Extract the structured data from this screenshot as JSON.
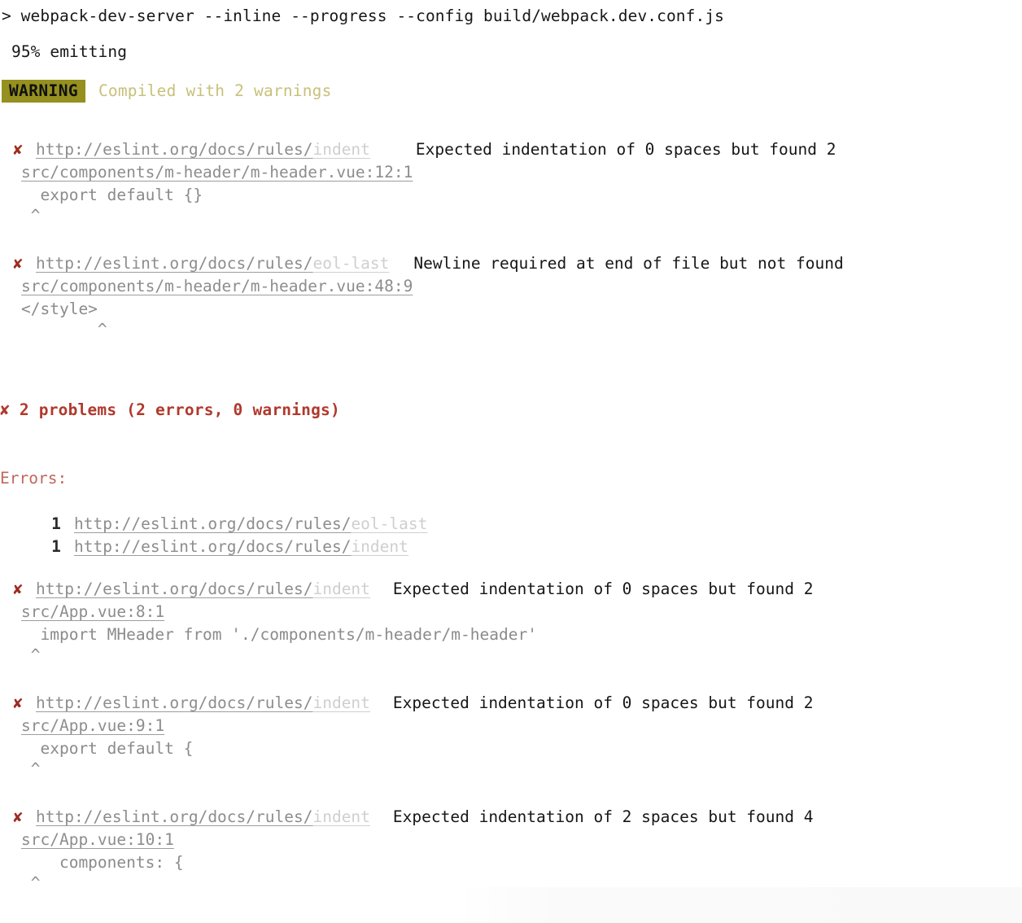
{
  "command": {
    "prompt": ">",
    "text": "> webpack-dev-server --inline --progress --config build/webpack.dev.conf.js"
  },
  "progress": {
    "text": "95% emitting"
  },
  "warning_banner": {
    "badge": "WARNING",
    "message": "Compiled with 2 warnings",
    "badge_bg": "#95901f",
    "badge_fg": "#101010",
    "message_color": "#c8c07a"
  },
  "icons": {
    "error_mark": "✘",
    "caret": "^"
  },
  "url_base": "http://eslint.org/docs/rules/",
  "problems": [
    {
      "mark": "✘",
      "rule": "indent",
      "message": "Expected indentation of 0 spaces but found 2",
      "file": "src/components/m-header/m-header.vue:12:1",
      "code": "  export default {}",
      "caret": " ^"
    },
    {
      "mark": "✘",
      "rule": "eol-last",
      "message": "Newline required at end of file but not found",
      "file": "src/components/m-header/m-header.vue:48:9",
      "code": "</style>",
      "caret": "        ^"
    }
  ],
  "summary": {
    "mark": "✘",
    "text": "✘ 2 problems (2 errors, 0 warnings)",
    "color": "#b0392c"
  },
  "errors_section": {
    "heading": "Errors:",
    "heading_color": "#c0675c",
    "rows": [
      {
        "count": "1",
        "rule": "eol-last"
      },
      {
        "count": "1",
        "rule": "indent"
      }
    ]
  },
  "problems2": [
    {
      "mark": "✘",
      "rule": "indent",
      "message": "Expected indentation of 0 spaces but found 2",
      "file": "src/App.vue:8:1",
      "code": "  import MHeader from './components/m-header/m-header'",
      "caret": " ^"
    },
    {
      "mark": "✘",
      "rule": "indent",
      "message": "Expected indentation of 0 spaces but found 2",
      "file": "src/App.vue:9:1",
      "code": "  export default {",
      "caret": " ^"
    },
    {
      "mark": "✘",
      "rule": "indent",
      "message": "Expected indentation of 2 spaces but found 4",
      "file": "src/App.vue:10:1",
      "code": "    components: {",
      "caret": " ^"
    }
  ],
  "colors": {
    "background": "#ffffff",
    "foreground": "#171717",
    "link": "#8d8d8d",
    "rule_name": "#cfcfcf",
    "code": "#8b8b8b",
    "error_red": "#9e2b20"
  }
}
